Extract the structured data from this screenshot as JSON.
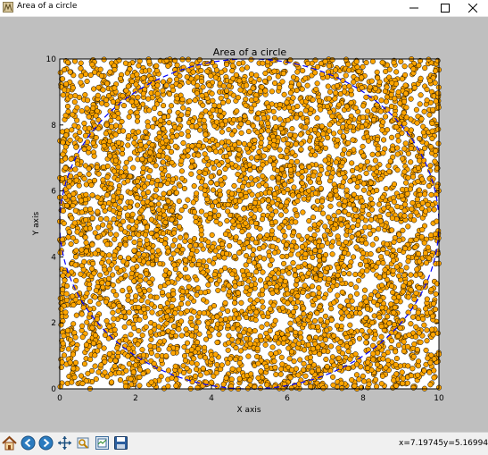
{
  "window": {
    "title": "Area of a circle",
    "icons": {
      "app": "matplotlib-app-icon",
      "minimize": "minimize-icon",
      "maximize": "maximize-icon",
      "close": "close-icon"
    }
  },
  "toolbar": {
    "buttons": [
      {
        "name": "home-button",
        "icon": "home-icon",
        "tooltip_action": "Reset original view"
      },
      {
        "name": "back-button",
        "icon": "back-arrow-icon",
        "tooltip_action": "Back"
      },
      {
        "name": "forward-button",
        "icon": "forward-arrow-icon",
        "tooltip_action": "Forward"
      },
      {
        "name": "pan-button",
        "icon": "pan-move-icon",
        "tooltip_action": "Pan"
      },
      {
        "name": "zoom-button",
        "icon": "zoom-rect-icon",
        "tooltip_action": "Zoom"
      },
      {
        "name": "subplots-button",
        "icon": "subplots-config-icon",
        "tooltip_action": "Configure subplots"
      },
      {
        "name": "save-button",
        "icon": "floppy-disk-icon",
        "tooltip_action": "Save"
      }
    ],
    "coord_x": "x=7.19745",
    "coord_y": "y=5.16994"
  },
  "colors": {
    "figure_background": "#bfbfbf",
    "axes_background": "#ffffff",
    "marker_fill": "#ffa500",
    "marker_edge": "#000000",
    "circle_line": "#0000ff"
  },
  "chart_data": {
    "type": "scatter",
    "title": "Area of a circle",
    "xlabel": "X axis",
    "ylabel": "Y axis",
    "xlim": [
      0,
      10
    ],
    "ylim": [
      0,
      10
    ],
    "xticks": [
      0,
      2,
      4,
      6,
      8,
      10
    ],
    "yticks": [
      0,
      2,
      4,
      6,
      8,
      10
    ],
    "grid": false,
    "marker": "circle",
    "approx_point_count": 5000,
    "points_distribution": "uniform random over [0,10]x[0,10]",
    "overlay_circle": {
      "center": [
        5,
        5
      ],
      "radius": 5,
      "style": "dashed"
    }
  }
}
